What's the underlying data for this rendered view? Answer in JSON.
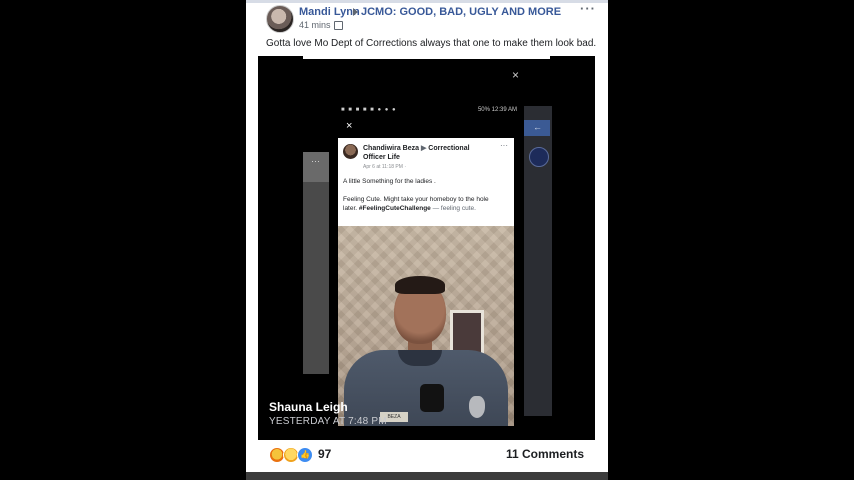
{
  "post": {
    "author": "Mandi Lynn",
    "group": "JCMO: GOOD, BAD, UGLY AND MORE",
    "time": "41 mins ·",
    "status_text": "Gotta love Mo Dept of Corrections always that one to make them look bad.",
    "more_label": "···"
  },
  "media": {
    "close_label": "×",
    "shared_by": "Shauna Leigh",
    "shared_time": "YESTERDAY AT 7:48 PM"
  },
  "phone": {
    "status_right": "50% 12:39 AM",
    "close_label": "×",
    "fb_post": {
      "author": "Chandiwira Beza",
      "page": "Correctional Officer Life",
      "time": "Apr 6 at 11:18 PM · ",
      "line1": "A little Something for the ladies .",
      "line2": "Feeling Cute.  Might take your homeboy to the hole",
      "line3_prefix": "later. ",
      "hashtag": "#FeelingCuteChallenge",
      "feeling": " — feeling cute."
    },
    "nametag": "BEZA"
  },
  "footer": {
    "reaction_count": "97",
    "comments": "11 Comments"
  },
  "icons": {
    "arrow": "triangle-right-icon",
    "group": "group-icon",
    "like": "like-icon"
  }
}
